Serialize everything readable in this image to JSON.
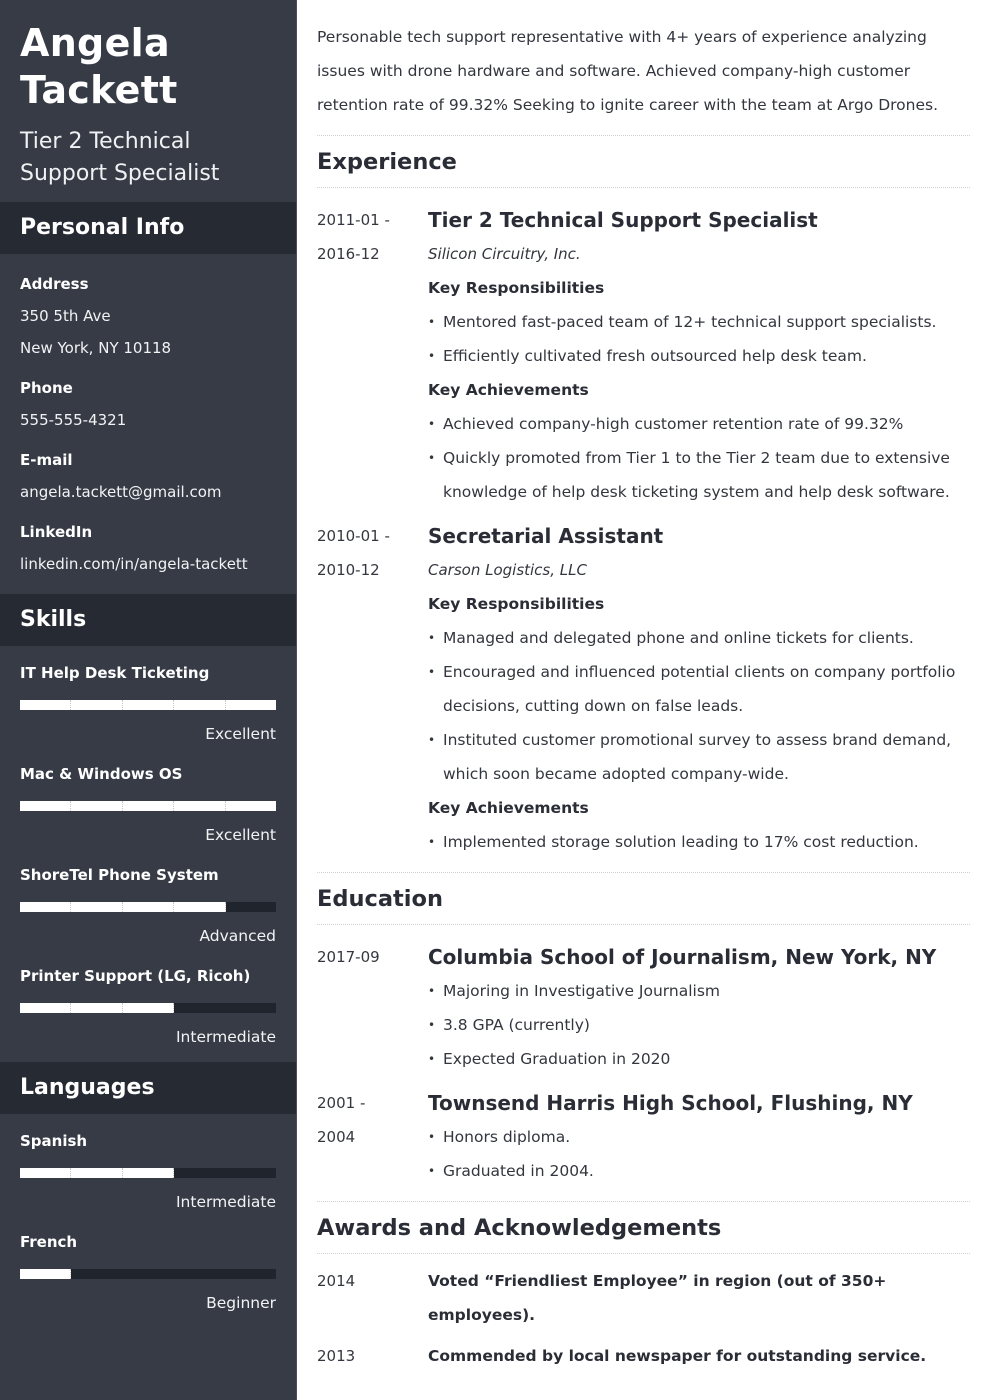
{
  "profile": {
    "first_name": "Angela",
    "last_name": "Tackett",
    "title_line1": "Tier 2 Technical",
    "title_line2": "Support Specialist"
  },
  "personal_info": {
    "heading": "Personal Info",
    "address_label": "Address",
    "address_line1": "350 5th Ave",
    "address_line2": "New York, NY 10118",
    "phone_label": "Phone",
    "phone": "555-555-4321",
    "email_label": "E-mail",
    "email": "angela.tackett@gmail.com",
    "linkedin_label": "LinkedIn",
    "linkedin": "linkedin.com/in/angela-tackett"
  },
  "skills": {
    "heading": "Skills",
    "scale_max": 5,
    "items": [
      {
        "name": "IT Help Desk Ticketing",
        "level": "Excellent",
        "score": 5
      },
      {
        "name": "Mac & Windows OS",
        "level": "Excellent",
        "score": 5
      },
      {
        "name": "ShoreTel Phone System",
        "level": "Advanced",
        "score": 4
      },
      {
        "name": "Printer Support (LG, Ricoh)",
        "level": "Intermediate",
        "score": 3
      }
    ]
  },
  "languages": {
    "heading": "Languages",
    "scale_max": 5,
    "items": [
      {
        "name": "Spanish",
        "level": "Intermediate",
        "score": 3
      },
      {
        "name": "French",
        "level": "Beginner",
        "score": 1
      }
    ]
  },
  "summary": "Personable tech support representative with 4+ years of experience analyzing issues with drone hardware and software. Achieved company-high customer retention rate of 99.32% Seeking to ignite career with the team at Argo Drones.",
  "experience": {
    "heading": "Experience",
    "jobs": [
      {
        "date_start": "2011-01 -",
        "date_end": "2016-12",
        "title": "Tier 2 Technical Support Specialist",
        "company": "Silicon Circuitry, Inc.",
        "resp_heading": "Key Responsibilities",
        "responsibilities": [
          "Mentored fast-paced team of 12+ technical support specialists.",
          "Efficiently cultivated fresh outsourced help desk team."
        ],
        "ach_heading": "Key Achievements",
        "achievements": [
          "Achieved company-high customer retention rate of 99.32%",
          "Quickly promoted from Tier 1 to the Tier 2 team due to extensive knowledge of help desk ticketing system and help desk software."
        ]
      },
      {
        "date_start": "2010-01 -",
        "date_end": "2010-12",
        "title": "Secretarial Assistant",
        "company": "Carson Logistics, LLC",
        "resp_heading": "Key Responsibilities",
        "responsibilities": [
          "Managed and delegated phone and online tickets for clients.",
          "Encouraged and influenced potential clients on company portfolio decisions, cutting down on false leads.",
          "Instituted customer promotional survey to assess brand demand, which soon became adopted company-wide."
        ],
        "ach_heading": "Key Achievements",
        "achievements": [
          "Implemented storage solution leading to 17% cost reduction."
        ]
      }
    ]
  },
  "education": {
    "heading": "Education",
    "items": [
      {
        "date_start": "2017-09",
        "date_end": "",
        "school": "Columbia School of Journalism, New York, NY",
        "details": [
          "Majoring in Investigative Journalism",
          "3.8 GPA (currently)",
          "Expected Graduation in 2020"
        ]
      },
      {
        "date_start": "2001 -",
        "date_end": "2004",
        "school": "Townsend Harris High School, Flushing, NY",
        "details": [
          "Honors diploma.",
          "Graduated in 2004."
        ]
      }
    ]
  },
  "awards": {
    "heading": "Awards and Acknowledgements",
    "items": [
      {
        "year": "2014",
        "text": "Voted “Friendliest Employee” in region (out of 350+ employees)."
      },
      {
        "year": "2013",
        "text": "Commended by local newspaper for outstanding service."
      }
    ]
  }
}
